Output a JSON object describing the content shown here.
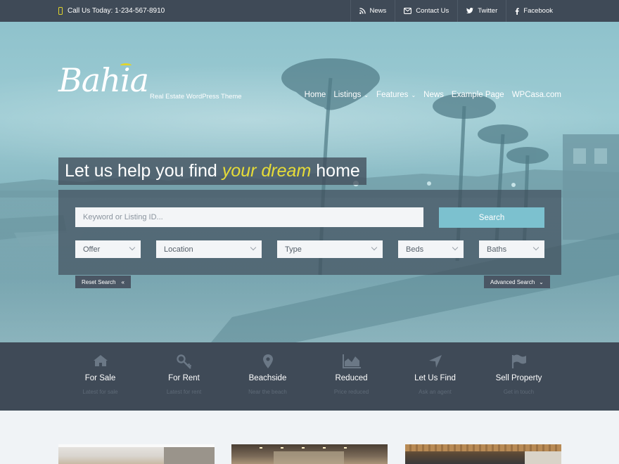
{
  "topbar": {
    "call_text": "Call Us Today: 1-234-567-8910",
    "links": [
      {
        "label": "News",
        "icon": "rss-icon"
      },
      {
        "label": "Contact Us",
        "icon": "envelope-icon"
      },
      {
        "label": "Twitter",
        "icon": "twitter-icon"
      },
      {
        "label": "Facebook",
        "icon": "facebook-icon"
      }
    ]
  },
  "brand": {
    "logo_text": "Bahia",
    "tagline": "Real Estate WordPress Theme",
    "accent_color": "#e0d42c"
  },
  "nav": {
    "items": [
      {
        "label": "Home"
      },
      {
        "label": "Listings"
      },
      {
        "label": "Features"
      },
      {
        "label": "News"
      },
      {
        "label": "Example Page"
      },
      {
        "label": "WPCasa.com"
      }
    ]
  },
  "headline": {
    "before": "Let us help you find",
    "highlight": "your dream",
    "after": "home"
  },
  "search": {
    "placeholder": "Keyword or Listing ID...",
    "button": "Search",
    "offer": "Offer",
    "location": "Location",
    "type": "Type",
    "beds": "Beds",
    "baths": "Baths",
    "reset": "Reset Search",
    "advanced": "Advanced Search"
  },
  "categories": [
    {
      "title": "For Sale",
      "subtitle": "Latest for sale",
      "icon": "house-icon"
    },
    {
      "title": "For Rent",
      "subtitle": "Latest for rent",
      "icon": "key-icon"
    },
    {
      "title": "Beachside",
      "subtitle": "Near the beach",
      "icon": "map-pin-icon"
    },
    {
      "title": "Reduced",
      "subtitle": "Price reduced",
      "icon": "area-chart-icon"
    },
    {
      "title": "Let Us Find",
      "subtitle": "Ask an agent",
      "icon": "location-arrow-icon"
    },
    {
      "title": "Sell Property",
      "subtitle": "Get in touch",
      "icon": "flag-icon"
    }
  ]
}
